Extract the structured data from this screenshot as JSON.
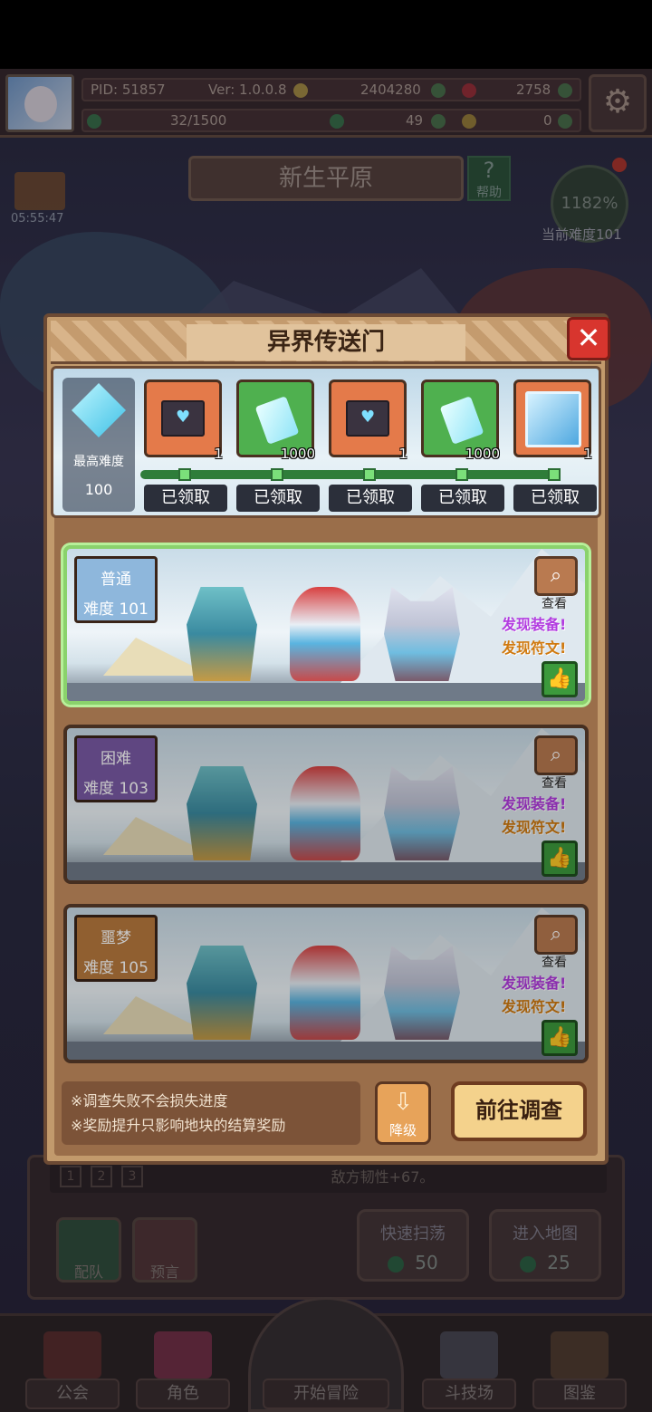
{
  "hud": {
    "pid": "PID: 51857",
    "version": "Ver: 1.0.0.8",
    "gold": "2404280",
    "gems": "2758",
    "stamina": "32/1500",
    "clover": "49",
    "keys": "0"
  },
  "map": {
    "title": "新生平原",
    "help_label": "帮助",
    "help_glyph": "?",
    "gift_timer": "05:55:47",
    "progress_percent": "1182%",
    "current_difficulty": "当前难度101"
  },
  "modal": {
    "title": "异界传送门",
    "close_glyph": "✕",
    "max_difficulty_label": "最高难度",
    "max_difficulty_value": "100",
    "rewards": [
      {
        "type": "mail-icon",
        "qty": "1",
        "status": "已领取"
      },
      {
        "type": "crystal-icon",
        "qty": "1000",
        "status": "已领取"
      },
      {
        "type": "mail-icon",
        "qty": "1",
        "status": "已领取"
      },
      {
        "type": "crystal-icon",
        "qty": "1000",
        "status": "已领取"
      },
      {
        "type": "frame-icon",
        "qty": "1",
        "status": "已领取"
      }
    ],
    "stages": [
      {
        "mode": "普通",
        "level": "难度 101",
        "view": "查看",
        "found_equipment": "发现装备!",
        "found_rune": "发现符文!"
      },
      {
        "mode": "困难",
        "level": "难度 103",
        "view": "查看",
        "found_equipment": "发现装备!",
        "found_rune": "发现符文!"
      },
      {
        "mode": "噩梦",
        "level": "难度 105",
        "view": "查看",
        "found_equipment": "发现装备!",
        "found_rune": "发现符文!"
      }
    ],
    "notes": [
      "※调查失败不会损失进度",
      "※奖励提升只影响地块的结算奖励"
    ],
    "downgrade_label": "降级",
    "goto_label": "前往调查"
  },
  "background": {
    "enemy_line": "敌方韧性+67。",
    "tabs": [
      "1",
      "2",
      "3"
    ],
    "team_label": "配队",
    "prophecy_label": "预言",
    "sweep_label": "快速扫荡",
    "sweep_cost": "50",
    "enter_label": "进入地图",
    "enter_cost": "25"
  },
  "nav": {
    "guild": "公会",
    "character": "角色",
    "start": "开始冒险",
    "arena": "斗技场",
    "codex": "图鉴"
  },
  "colors": {
    "accent_green": "#8ad26c",
    "close_red": "#d8352e",
    "rune_orange": "#d07a10",
    "equip_purple": "#b23ce0"
  }
}
